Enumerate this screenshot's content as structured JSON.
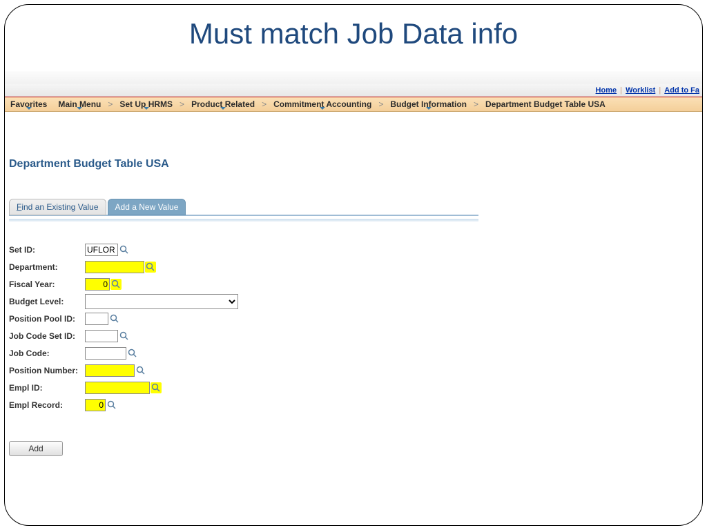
{
  "slide_title": "Must match Job Data info",
  "header_links": {
    "home": "Home",
    "worklist": "Worklist",
    "add_to": "Add to Fa"
  },
  "breadcrumb": {
    "favorites": "Favorites",
    "main_menu": "Main Menu",
    "setup_hrms": "Set Up HRMS",
    "product_related": "Product Related",
    "commitment_accounting": "Commitment Accounting",
    "budget_information": "Budget Information",
    "dept_budget_table": "Department Budget Table USA"
  },
  "page_heading": "Department Budget Table USA",
  "tabs": {
    "find": "Find an Existing Value",
    "find_ul_char": "F",
    "find_rest": "ind an Existing Value",
    "add_new": "Add a New Value"
  },
  "form": {
    "labels": {
      "set_id": "Set ID:",
      "department": "Department:",
      "fiscal_year": "Fiscal Year:",
      "budget_level": "Budget Level:",
      "position_pool_id": "Position Pool ID:",
      "job_code_set_id": "Job Code Set ID:",
      "job_code": "Job Code:",
      "position_number": "Position Number:",
      "empl_id": "Empl ID:",
      "empl_record": "Empl Record:"
    },
    "values": {
      "set_id": "UFLOR",
      "department": "",
      "fiscal_year": "0",
      "budget_level": "",
      "position_pool_id": "",
      "job_code_set_id": "",
      "job_code": "",
      "position_number": "",
      "empl_id": "",
      "empl_record": "0"
    }
  },
  "buttons": {
    "add": "Add"
  }
}
